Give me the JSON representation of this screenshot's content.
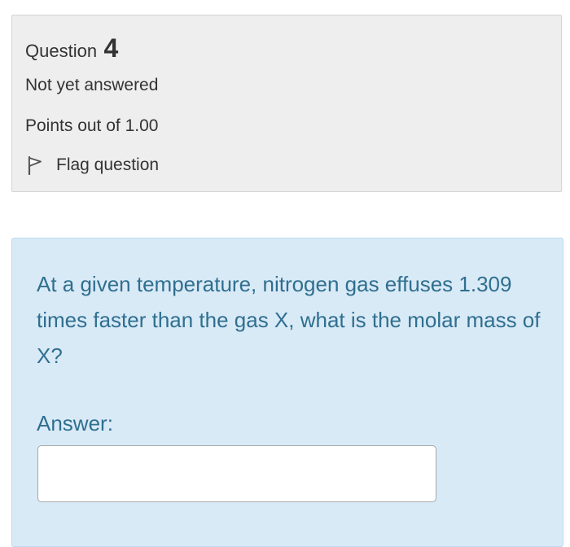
{
  "info": {
    "question_label": "Question",
    "question_number": "4",
    "state": "Not yet answered",
    "grade": "Points out of 1.00",
    "flag_label": "Flag question",
    "flag_icon": "flag-outline-icon"
  },
  "question": {
    "text": "At a given temperature, nitrogen gas effuses 1.309 times faster than the gas X, what is the molar mass of X?",
    "answer_label": "Answer:",
    "answer_value": "",
    "answer_placeholder": ""
  },
  "colors": {
    "info_background": "#eeeeee",
    "content_background": "#d9eaf7",
    "question_text": "#2f6f8f",
    "info_text": "#333333"
  }
}
